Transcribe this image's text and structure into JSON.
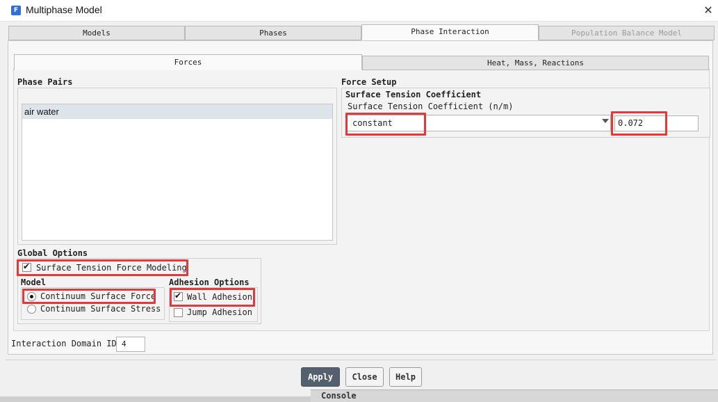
{
  "window": {
    "title": "Multiphase Model",
    "icon_letter": "F",
    "close_glyph": "✕"
  },
  "tabs": [
    {
      "label": "Models",
      "active": false,
      "disabled": false
    },
    {
      "label": "Phases",
      "active": false,
      "disabled": false
    },
    {
      "label": "Phase Interaction",
      "active": true,
      "disabled": false
    },
    {
      "label": "Population Balance Model",
      "active": false,
      "disabled": true
    }
  ],
  "subtabs": [
    {
      "label": "Forces",
      "active": true
    },
    {
      "label": "Heat, Mass, Reactions",
      "active": false
    }
  ],
  "phase_pairs": {
    "title": "Phase Pairs",
    "items": [
      "air water"
    ]
  },
  "force_setup": {
    "title": "Force Setup",
    "group_title": "Surface Tension Coefficient",
    "field_label": "Surface Tension Coefficient (n/m)",
    "method": "constant",
    "value": "0.072"
  },
  "global_options": {
    "title": "Global Options",
    "surface_tension_modeling": {
      "label": "Surface Tension Force Modeling",
      "checked": true
    },
    "model": {
      "title": "Model",
      "options": [
        {
          "label": "Continuum Surface Force",
          "selected": true
        },
        {
          "label": "Continuum Surface Stress",
          "selected": false
        }
      ]
    },
    "adhesion": {
      "title": "Adhesion Options",
      "wall_adhesion": {
        "label": "Wall Adhesion",
        "checked": true
      },
      "jump_adhesion": {
        "label": "Jump Adhesion",
        "checked": false
      }
    }
  },
  "interaction_domain": {
    "label": "Interaction Domain ID",
    "value": "4"
  },
  "buttons": {
    "apply": "Apply",
    "close": "Close",
    "help": "Help"
  },
  "console": {
    "label": "Console"
  },
  "colors": {
    "highlight": "#e03a3a",
    "apply_bg": "#54606e",
    "selection": "#dfe3ea"
  }
}
